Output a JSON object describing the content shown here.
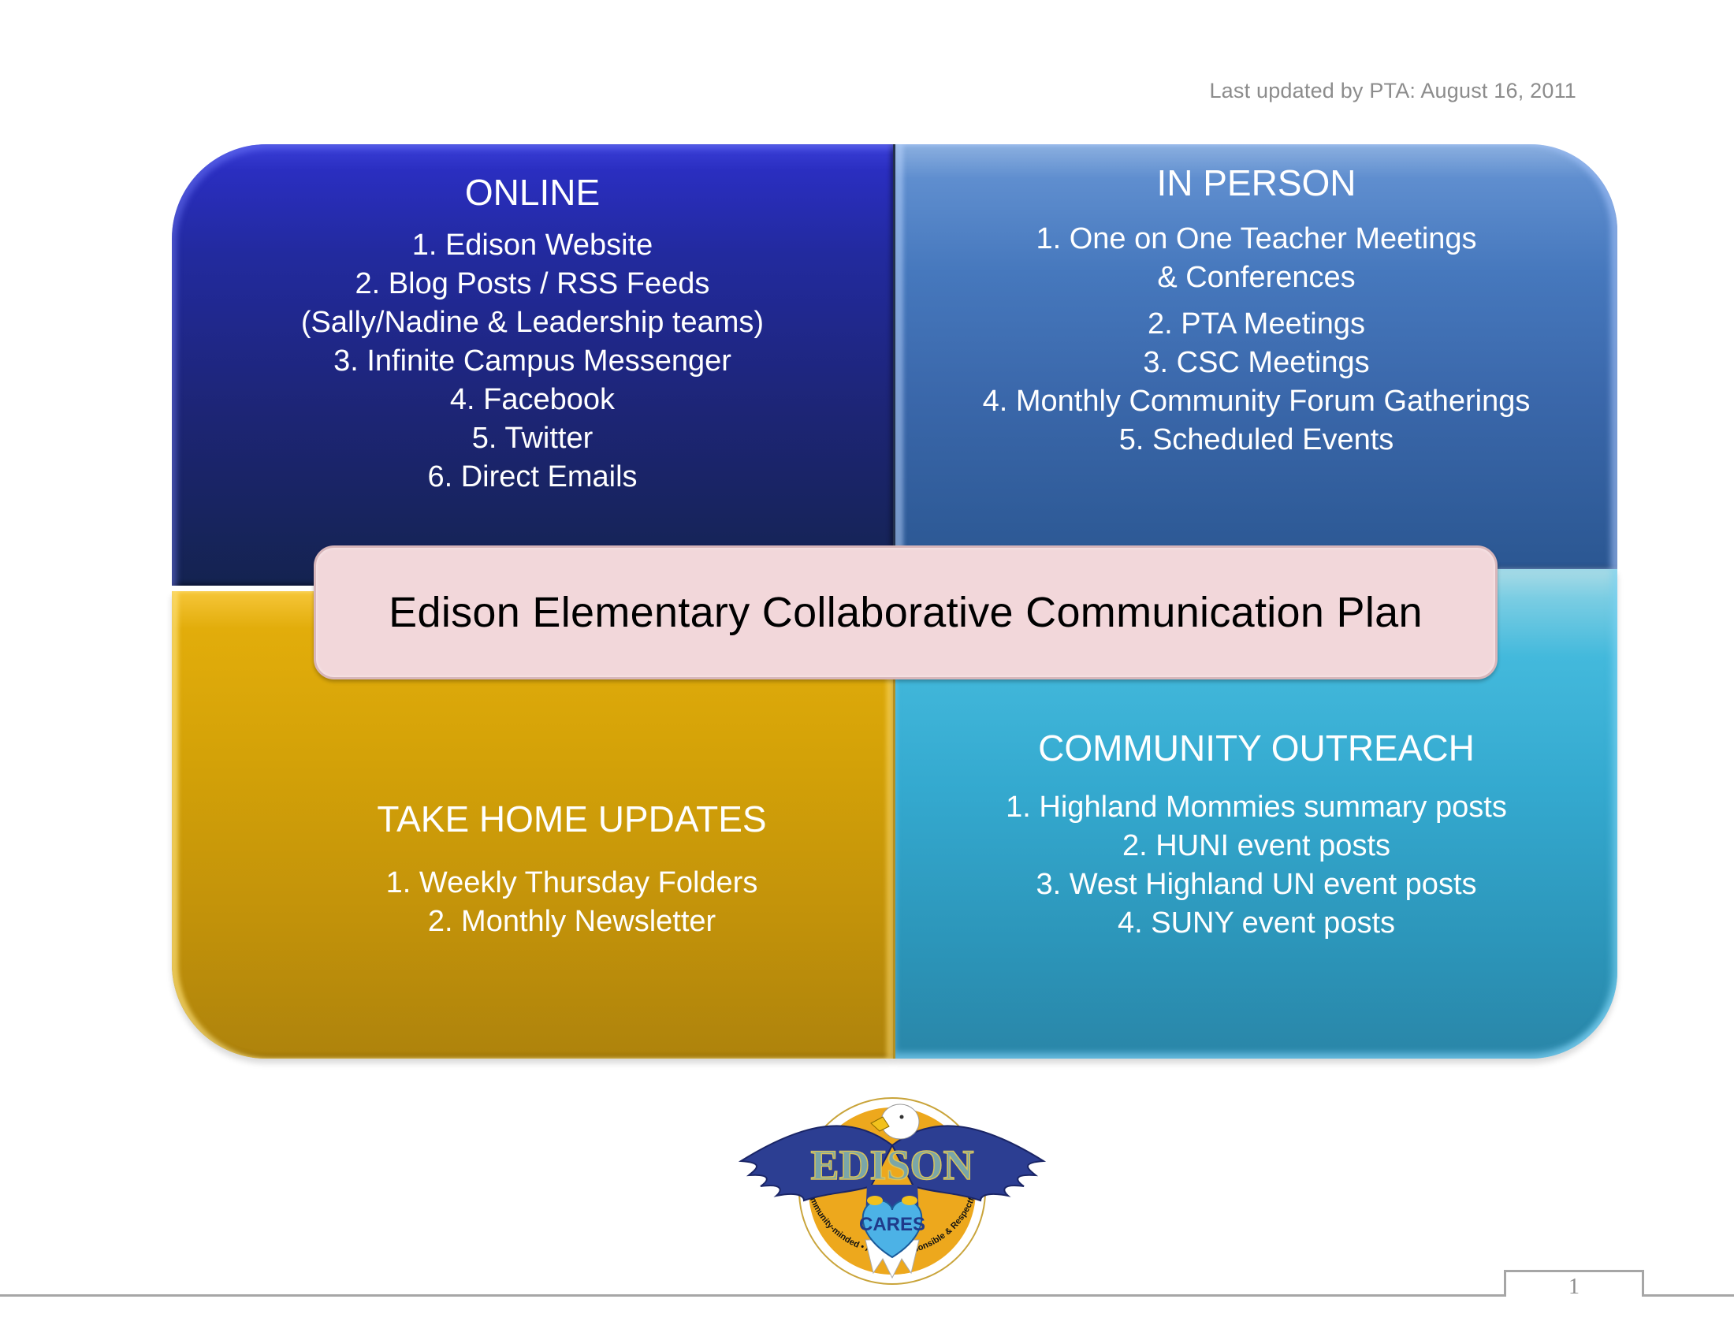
{
  "header": {
    "last_updated": "Last updated by PTA: August 16, 2011"
  },
  "center": {
    "title": "Edison Elementary Collaborative Communication Plan",
    "background_color": "#f2d7da"
  },
  "quadrants": {
    "online": {
      "heading": "ONLINE",
      "color": "#1d2576",
      "items": [
        "1. Edison Website",
        "2. Blog Posts / RSS Feeds",
        "(Sally/Nadine & Leadership teams)",
        "3. Infinite Campus Messenger",
        "4. Facebook",
        "5. Twitter",
        "6. Direct Emails"
      ]
    },
    "in_person": {
      "heading": "IN PERSON",
      "color": "#3a67aa",
      "items": [
        "1. One on One Teacher Meetings",
        "& Conferences",
        "2. PTA Meetings",
        "3. CSC Meetings",
        "4.  Monthly Community Forum Gatherings",
        "5. Scheduled Events"
      ]
    },
    "take_home": {
      "heading": "TAKE HOME UPDATES",
      "color": "#c2920a",
      "items": [
        "1.  Weekly Thursday Folders",
        "2. Monthly Newsletter"
      ]
    },
    "community_outreach": {
      "heading": "COMMUNITY OUTREACH",
      "color": "#34a9cf",
      "items": [
        "1. Highland Mommies summary posts",
        "2. HUNI event posts",
        "3. West Highland UN event posts",
        "4. SUNY event posts"
      ]
    }
  },
  "logo": {
    "icon": "edison-eagle-logo",
    "name": "EDISON",
    "badge": "CARES",
    "motto": "Community-minded • Aware • Responsible & Respectful • Empathetic • Safe"
  },
  "footer": {
    "page_number": "1"
  }
}
